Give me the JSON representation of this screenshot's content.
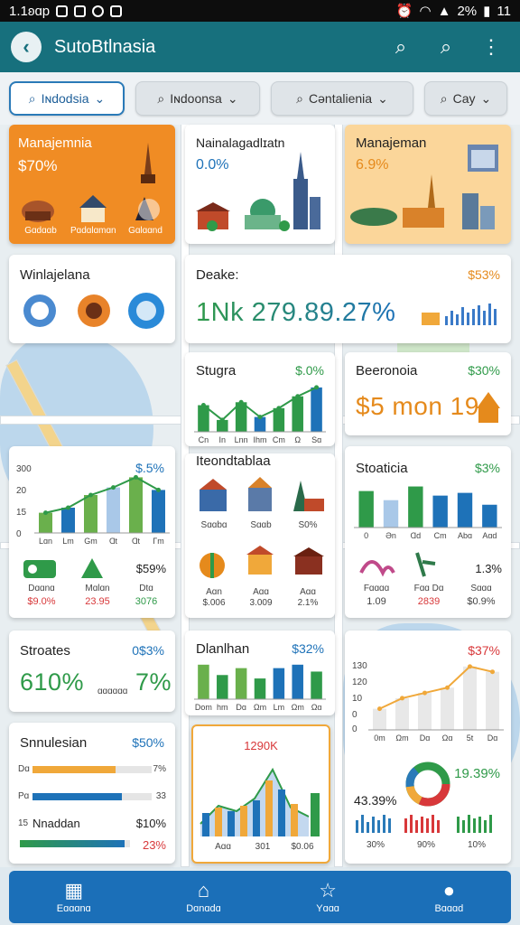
{
  "status_bar": {
    "time": "1.1ʚɑp",
    "right": "2%",
    "clock": "11"
  },
  "header": {
    "title": "SutoBtlnasia"
  },
  "filters": [
    {
      "label": "Iɴdodsia",
      "active": true
    },
    {
      "label": "Iɴdoonsa"
    },
    {
      "label": "Cəntalienia"
    },
    {
      "label": "Cay"
    }
  ],
  "cards": {
    "c1": {
      "title": "Manajemnia",
      "value": "$70%",
      "labels": [
        "Gɑdɑɑb",
        "Pɑdɑlɑmɑn",
        "Gɑlɑɑnd"
      ]
    },
    "c2": {
      "title": "Nainalagadlɪatn",
      "value": "0.0%"
    },
    "c3": {
      "title": "Manajeman",
      "value": "6.9%"
    },
    "c4": {
      "title": "Winlajelana"
    },
    "c5": {
      "title": "Deake:",
      "pct": "$53%",
      "big": "1Nk 279.89.27%"
    },
    "c6": {
      "title": "Stugra",
      "pct": "$.0%",
      "ticks": [
        "Cn",
        "In",
        "Lnn",
        "Ihm",
        "Cm",
        "Ω",
        "Sɑ"
      ]
    },
    "c7": {
      "title": "Beeronoia",
      "pct": "$30%",
      "big": "$5 mon 19"
    },
    "c8": {
      "pct": "$.5%",
      "yticks": [
        "300",
        "20",
        "15",
        "0"
      ],
      "ticks": [
        "Lɑn",
        "Lm",
        "Gm",
        "Ɑt",
        "Ɑt",
        "Γm"
      ],
      "items": [
        {
          "label": "Dɑɑnɑ",
          "value": "$9.0%"
        },
        {
          "label": "Mɑlɑn",
          "value": "23.95"
        },
        {
          "label": "Dtɑ",
          "value": "3076"
        }
      ],
      "extra_pct": "$59%"
    },
    "c9": {
      "title": "Iteondtablaa",
      "row1": [
        "Sɑɑbɑ",
        "Sɑɑb",
        "S0%"
      ],
      "row2": [
        "Aɑn",
        "Aɑɑ",
        "Aɑɑ"
      ],
      "row2v": [
        "$.006",
        "3.009",
        "2.1%"
      ]
    },
    "c10": {
      "title": "Stoaticia",
      "pct": "$3%",
      "ticks": [
        "0",
        "Ən",
        "Ɑd",
        "Cm",
        "Abɑ",
        "Aɑd"
      ],
      "items": [
        {
          "label": "Fɑɑɑɑ",
          "value": "1.09"
        },
        {
          "label": "Fɑɑ Dɑ",
          "value": "2839"
        },
        {
          "label": "Sɑɑɑ",
          "value": "$0.9%"
        }
      ],
      "extra_pct": "1.3%"
    },
    "c11": {
      "title": "Stroates",
      "pct": "0$3%",
      "big1": "610%",
      "mid": "ɑɑɑɑɑɑ",
      "big2": "7%"
    },
    "c12": {
      "title": "Dlanlhan",
      "pct": "$32%",
      "ticks": [
        "Dom",
        "hm",
        "Dɑ",
        "Ωm",
        "Lm",
        "Ωm",
        "Ωɑ"
      ]
    },
    "c13": {
      "pct": "$37%",
      "yticks": [
        "130",
        "120",
        "10",
        "0",
        "0"
      ],
      "ticks": [
        "0m",
        "Ωm",
        "Dɑ",
        "Ωɑ",
        "5t",
        "Dɑ"
      ]
    },
    "c14": {
      "title": "Snnulesian",
      "pct": "$50%",
      "rows": [
        {
          "label": "Dɑ",
          "value": "7%"
        },
        {
          "label": "Pɑ",
          "value": "33"
        },
        {
          "label": "Nnaddan",
          "value": "$10%"
        },
        {
          "label": "",
          "value": "23%"
        }
      ],
      "prefix": "15"
    },
    "c15": {
      "top": "1290K",
      "ticks": [
        "Aɑɑ",
        "301",
        "$0.06"
      ]
    },
    "c16": {
      "pct": "19.39%",
      "left": "43.39%",
      "ticks": [
        "30%",
        "90%",
        "10%"
      ]
    }
  },
  "nav": [
    {
      "label": "Eɑɑɑnɑ",
      "icon": "building-icon"
    },
    {
      "label": "Dɑnɑdɑ",
      "icon": "house-icon"
    },
    {
      "label": "Yɑɑɑ",
      "icon": "star-icon"
    },
    {
      "label": "Bɑɑɑd",
      "icon": "chat-icon"
    }
  ],
  "chart_data": [
    {
      "type": "bar",
      "title": "Stugra",
      "categories": [
        "Cn",
        "In",
        "Lnn",
        "Ihm",
        "Cm",
        "Ω",
        "Sɑ"
      ],
      "values": [
        45,
        20,
        50,
        25,
        40,
        60,
        75
      ]
    },
    {
      "type": "bar",
      "categories": [
        "Lɑn",
        "Lm",
        "Gm",
        "Ɑt",
        "Ɑt",
        "Γm"
      ],
      "values": [
        8,
        10,
        15,
        18,
        22,
        17
      ],
      "ylim": [
        0,
        25
      ]
    },
    {
      "type": "bar",
      "title": "Stoaticia",
      "categories": [
        "0",
        "Ən",
        "Ɑd",
        "Cm",
        "Abɑ",
        "Aɑd"
      ],
      "values": [
        40,
        30,
        45,
        35,
        38,
        25
      ]
    },
    {
      "type": "bar",
      "title": "Dlanlhan",
      "categories": [
        "Dom",
        "hm",
        "Dɑ",
        "Ωm",
        "Lm",
        "Ωm",
        "Ωɑ"
      ],
      "values": [
        50,
        35,
        45,
        30,
        45,
        50,
        40
      ]
    },
    {
      "type": "bar",
      "categories": [
        "0m",
        "Ωm",
        "Dɑ",
        "Ωɑ",
        "5t",
        "Dɑ"
      ],
      "values": [
        40,
        60,
        70,
        80,
        120,
        110
      ],
      "ylim": [
        0,
        130
      ]
    }
  ]
}
